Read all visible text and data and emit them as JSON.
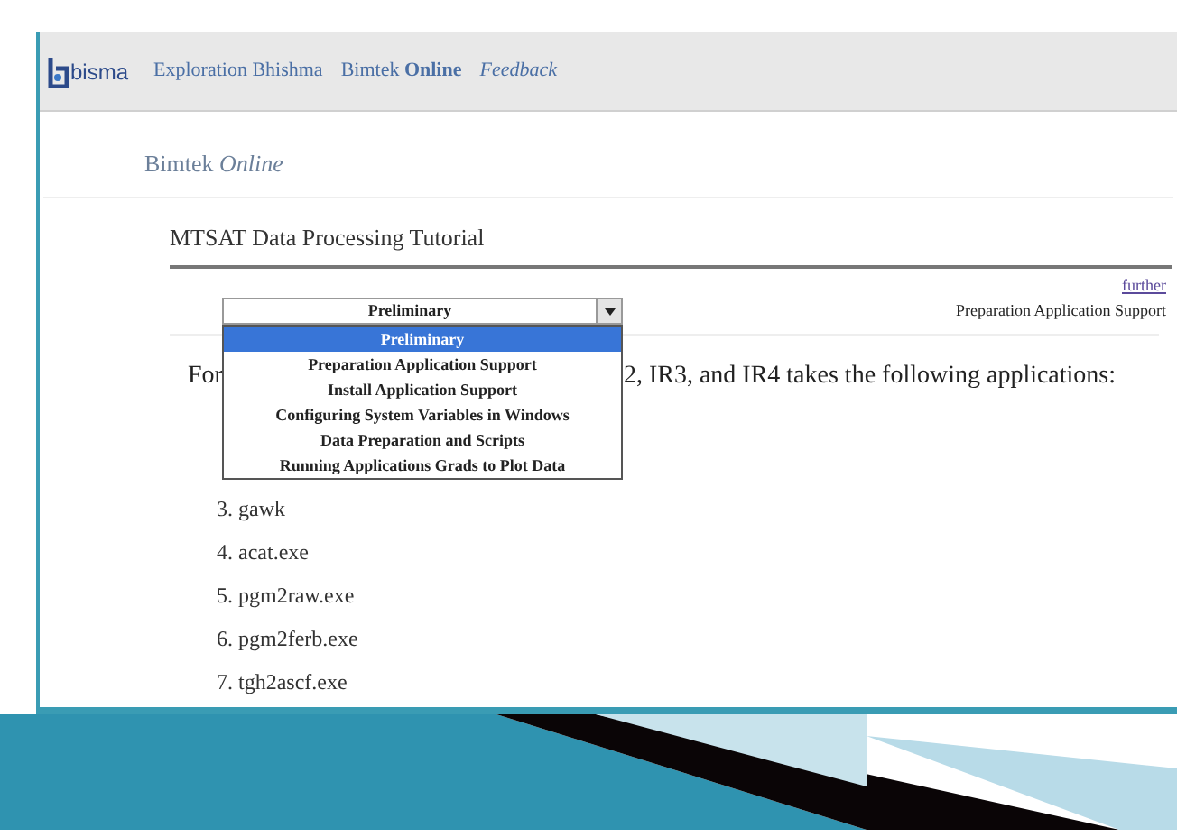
{
  "nav": {
    "logo_text": "bisma",
    "links": [
      {
        "text": "Exploration Bhishma",
        "kind": "plain"
      },
      {
        "text": "Bimtek **Online**",
        "kind": "mixed"
      },
      {
        "text": "Feedback",
        "kind": "italic"
      }
    ]
  },
  "section_title": "Bimtek *Online*",
  "page_title": "MTSAT Data Processing Tutorial",
  "dropdown": {
    "value": "Preliminary",
    "options": [
      {
        "label": "Preliminary",
        "selected": true
      },
      {
        "label": "Preparation Application Support",
        "selected": false
      },
      {
        "label": "Install Application Support",
        "selected": false
      },
      {
        "label": "Configuring System Variables in Windows",
        "selected": false
      },
      {
        "label": "Data Preparation and Scripts",
        "selected": false
      },
      {
        "label": "Running Applications Grads to Plot Data",
        "selected": false
      }
    ]
  },
  "further_link": "further",
  "next_page": "Preparation Application Support",
  "intro_start": "For",
  "intro_end": "2, IR3, and IR4 takes the following applications:",
  "applications": [
    "3. gawk",
    "4. acat.exe",
    "5. pgm2raw.exe",
    "6. pgm2ferb.exe",
    "7. tgh2ascf.exe"
  ]
}
